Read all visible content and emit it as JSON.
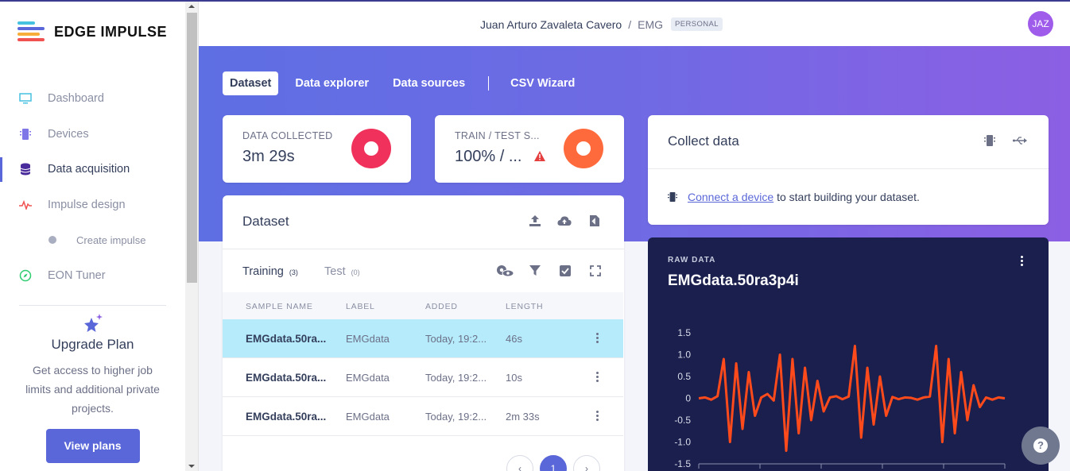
{
  "brand": {
    "name": "EDGE IMPULSE"
  },
  "sidebar": {
    "items": [
      {
        "label": "Dashboard",
        "icon": "monitor-icon"
      },
      {
        "label": "Devices",
        "icon": "chip-icon"
      },
      {
        "label": "Data acquisition",
        "icon": "database-icon",
        "active": true
      },
      {
        "label": "Impulse design",
        "icon": "pulse-icon"
      },
      {
        "label": "Create impulse",
        "icon": "dot-icon"
      },
      {
        "label": "EON Tuner",
        "icon": "compass-icon"
      }
    ],
    "upgrade": {
      "title": "Upgrade Plan",
      "description": "Get access to higher job limits and additional private projects.",
      "button": "View plans"
    }
  },
  "header": {
    "user": "Juan Arturo Zavaleta Cavero",
    "separator": "/",
    "project": "EMG",
    "badge": "PERSONAL",
    "avatar_initials": "JAZ"
  },
  "tabs": [
    "Dataset",
    "Data explorer",
    "Data sources",
    "CSV Wizard"
  ],
  "stats": {
    "collected": {
      "label": "DATA COLLECTED",
      "value": "3m 29s"
    },
    "split": {
      "label": "TRAIN / TEST S...",
      "value": "100% / ..."
    }
  },
  "dataset": {
    "title": "Dataset",
    "subtabs": [
      {
        "label": "Training",
        "count": "(3)"
      },
      {
        "label": "Test",
        "count": "(0)"
      }
    ],
    "columns": [
      "SAMPLE NAME",
      "LABEL",
      "ADDED",
      "LENGTH"
    ],
    "rows": [
      {
        "name": "EMGdata.50ra...",
        "label": "EMGdata",
        "added": "Today, 19:2...",
        "length": "46s"
      },
      {
        "name": "EMGdata.50ra...",
        "label": "EMGdata",
        "added": "Today, 19:2...",
        "length": "10s"
      },
      {
        "name": "EMGdata.50ra...",
        "label": "EMGdata",
        "added": "Today, 19:2...",
        "length": "2m 33s"
      }
    ],
    "page": "1"
  },
  "collect": {
    "title": "Collect data",
    "link": "Connect a device",
    "text": " to start building your dataset."
  },
  "raw_data": {
    "label": "RAW DATA",
    "title": "EMGdata.50ra3p4i"
  },
  "colors": {
    "accent": "#5a67d8",
    "signal": "#ff4a1c",
    "alert": "#e53e3e"
  },
  "chart_data": {
    "type": "line",
    "title": "",
    "xlabel": "",
    "ylabel": "",
    "ylim": [
      -1.5,
      1.5
    ],
    "yticks": [
      "1.5",
      "1.0",
      "0.5",
      "0",
      "-0.5",
      "-1.0",
      "-1.5"
    ],
    "series": [
      {
        "values": [
          0,
          0.02,
          -0.03,
          0.05,
          0.9,
          -1.0,
          0.8,
          -0.7,
          0.6,
          -0.4,
          0.02,
          0.1,
          -0.05,
          1.0,
          -1.2,
          0.9,
          -0.8,
          0.7,
          -0.5,
          0.4,
          -0.3,
          0.02,
          0.05,
          -0.02,
          0.04,
          1.2,
          -0.9,
          0.7,
          -0.6,
          0.5,
          -0.4,
          0.03,
          -0.02,
          0.02,
          0.01,
          -0.03,
          0.02,
          0.04,
          1.2,
          -1.0,
          0.9,
          -0.8,
          0.6,
          -0.5,
          0.3,
          -0.2,
          0.02,
          -0.03,
          0.02,
          0
        ]
      }
    ]
  }
}
